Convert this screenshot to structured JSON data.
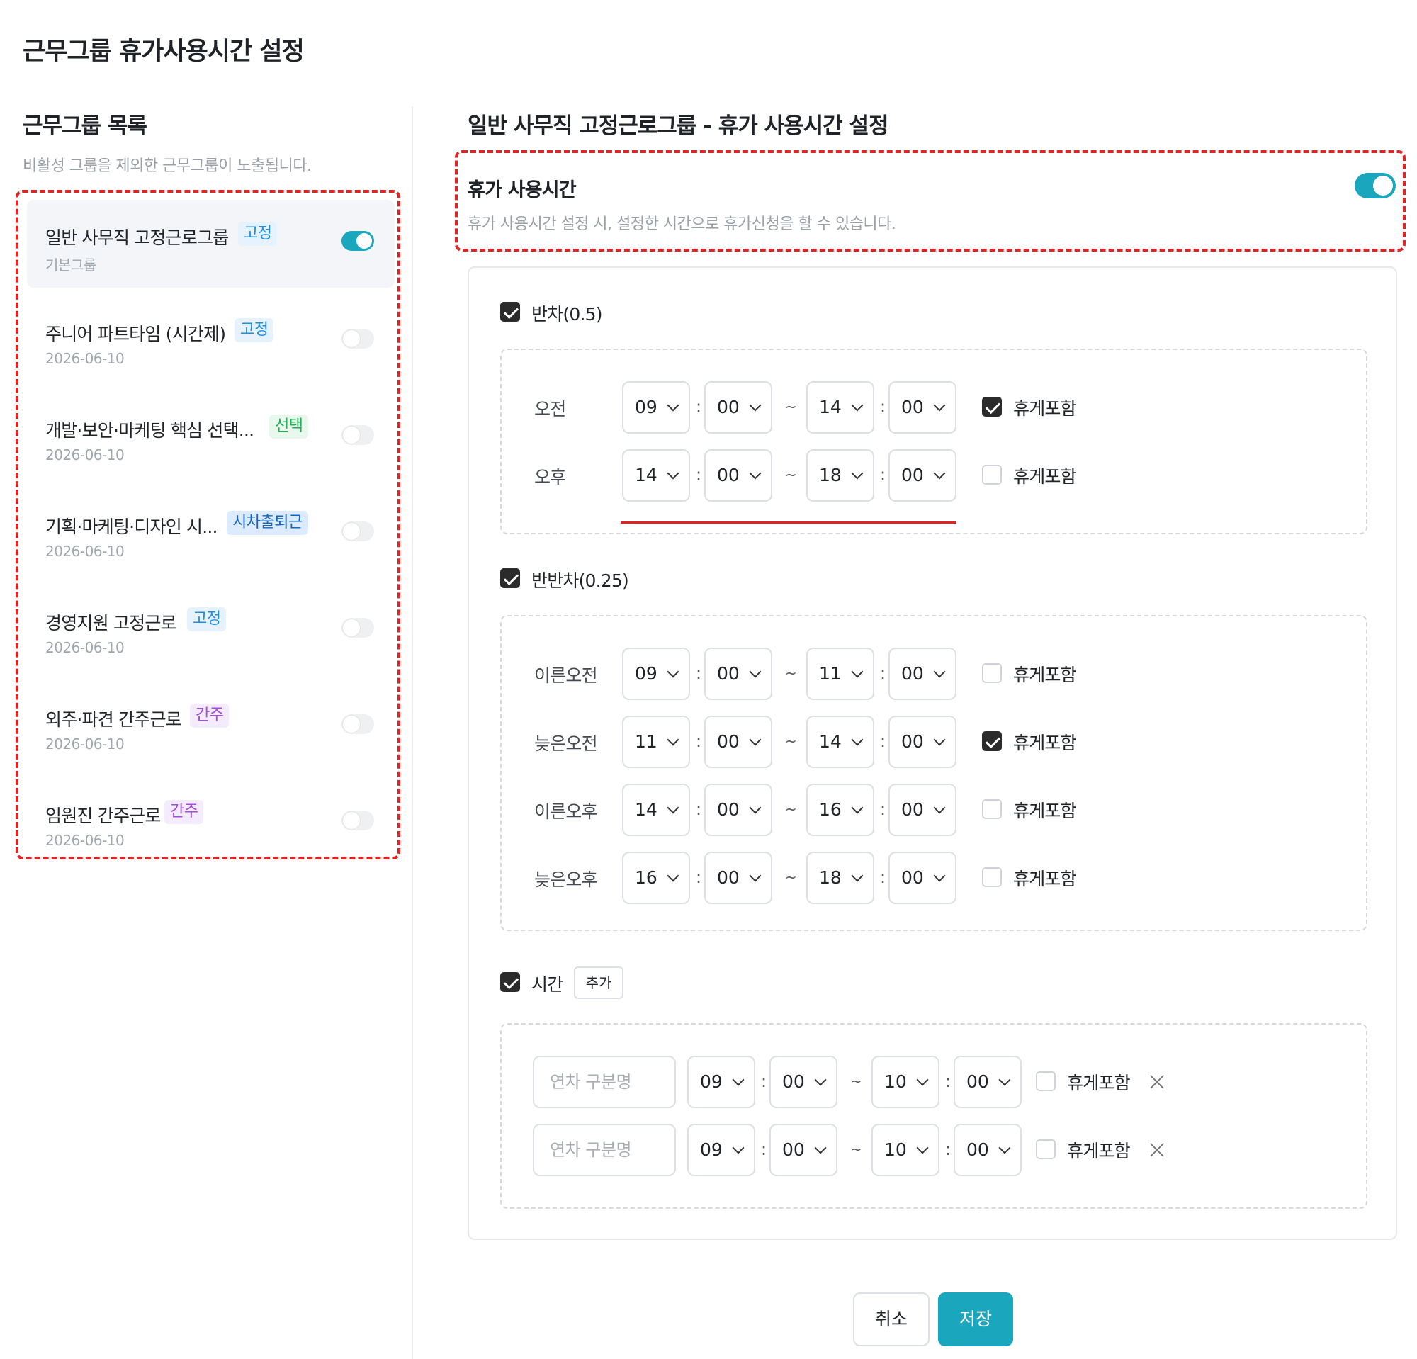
{
  "page": {
    "title": "근무그룹 휴가사용시간 설정"
  },
  "groups_panel": {
    "title": "근무그룹 목록",
    "description": "비활성 그룹을 제외한 근무그룹이 노출됩니다.",
    "items": [
      {
        "name": "일반 사무직 고정근로그룹",
        "badge": "고정",
        "sub": "기본그룹",
        "enabled": true
      },
      {
        "name": "주니어 파트타임 (시간제)",
        "badge": "고정",
        "sub": "2026-06-10",
        "enabled": false
      },
      {
        "name": "개발·보안·마케팅 핵심 선택...",
        "badge": "선택",
        "sub": "2026-06-10",
        "enabled": false
      },
      {
        "name": "기획·마케팅·디자인 시...",
        "badge": "시차출퇴근",
        "sub": "2026-06-10",
        "enabled": false
      },
      {
        "name": "경영지원 고정근로",
        "badge": "고정",
        "sub": "2026-06-10",
        "enabled": false
      },
      {
        "name": "외주·파견 간주근로",
        "badge": "간주",
        "sub": "2026-06-10",
        "enabled": false
      },
      {
        "name": "임원진 간주근로",
        "badge": "간주",
        "sub": "2026-06-10",
        "enabled": false
      }
    ]
  },
  "settings": {
    "title": "일반 사무직 고정근로그룹 - 휴가 사용시간 설정",
    "usage": {
      "title": "휴가 사용시간",
      "description": "휴가 사용시간 설정 시, 설정한 시간으로 휴가신청을 할 수 있습니다.",
      "enabled": true
    },
    "break_label": "휴게포함",
    "half_day": {
      "label": "반차(0.5)",
      "checked": true,
      "rows": [
        {
          "label": "오전",
          "start_h": "09",
          "start_m": "00",
          "end_h": "14",
          "end_m": "00",
          "break": true
        },
        {
          "label": "오후",
          "start_h": "14",
          "start_m": "00",
          "end_h": "18",
          "end_m": "00",
          "break": false
        }
      ]
    },
    "quarter_day": {
      "label": "반반차(0.25)",
      "checked": true,
      "rows": [
        {
          "label": "이른오전",
          "start_h": "09",
          "start_m": "00",
          "end_h": "11",
          "end_m": "00",
          "break": false
        },
        {
          "label": "늦은오전",
          "start_h": "11",
          "start_m": "00",
          "end_h": "14",
          "end_m": "00",
          "break": true
        },
        {
          "label": "이른오후",
          "start_h": "14",
          "start_m": "00",
          "end_h": "16",
          "end_m": "00",
          "break": false
        },
        {
          "label": "늦은오후",
          "start_h": "16",
          "start_m": "00",
          "end_h": "18",
          "end_m": "00",
          "break": false
        }
      ]
    },
    "hourly": {
      "label": "시간",
      "checked": true,
      "add_label": "추가",
      "name_placeholder": "연차 구분명",
      "rows": [
        {
          "start_h": "09",
          "start_m": "00",
          "end_h": "10",
          "end_m": "00",
          "break": false
        },
        {
          "start_h": "09",
          "start_m": "00",
          "end_h": "10",
          "end_m": "00",
          "break": false
        }
      ]
    },
    "time_separator": ":",
    "range_separator": "~"
  },
  "actions": {
    "cancel": "취소",
    "save": "저장"
  }
}
